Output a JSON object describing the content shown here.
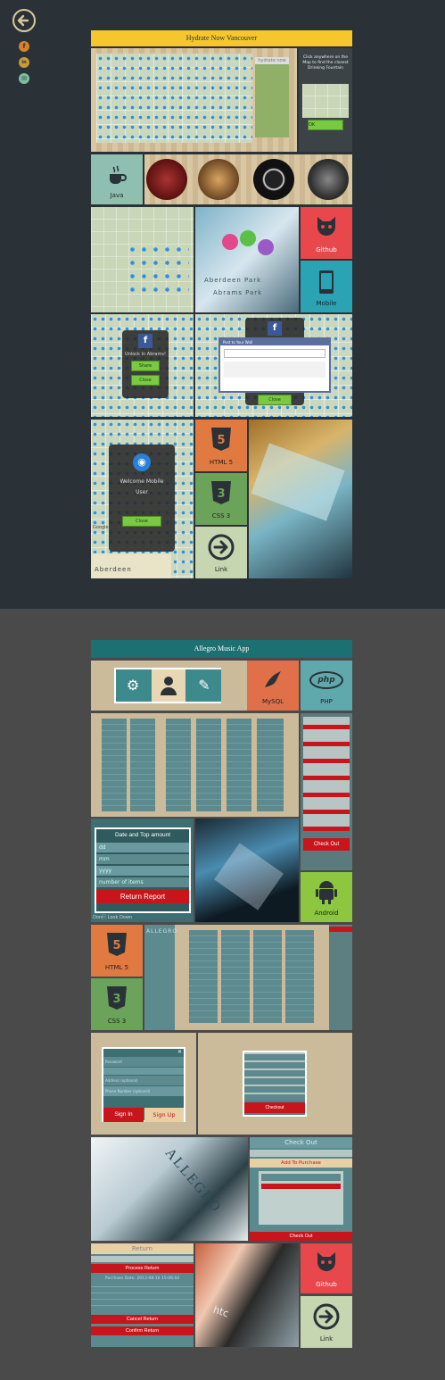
{
  "nav": {
    "back_icon": "circle-arrow-left-icon"
  },
  "social": {
    "items": [
      {
        "icon": "facebook-icon",
        "glyph": "f",
        "color": "#d9822b"
      },
      {
        "icon": "linkedin-icon",
        "glyph": "in",
        "color": "#c79a3a"
      },
      {
        "icon": "email-icon",
        "glyph": "✉",
        "color": "#7fbf9f"
      }
    ]
  },
  "project1": {
    "title": "Hydrate Now Vancouver",
    "header_color": "#f5c72c",
    "hero_modal_text": "Click anywhere on the Map to find the closest Drinking Fountain",
    "hero_ok": "OK",
    "map_logo": "hydrate now",
    "tile_java": "Java",
    "tile_github": "Github",
    "tile_mobile": "Mobile",
    "park_label_1": "Aberdeen Park",
    "park_label_2": "Abrams Park",
    "fb_modal_title": "Unlock In Abrams!",
    "fb_share": "Share",
    "fb_close": "Close",
    "post_dialog_title": "Post to Your Wall",
    "post_dialog_close": "Close",
    "welcome_title": "Welcome Mobile User",
    "welcome_close": "Close",
    "welcome_logo": "hydrate",
    "aberdeen": "Aberdeen",
    "tile_html5": "HTML 5",
    "tile_css3": "CSS 3",
    "tile_link": "Link",
    "google": "Google"
  },
  "project2": {
    "title": "Allegro Music App",
    "header_color": "#1d7071",
    "tile_mysql": "MySQL",
    "tile_php": "PHP",
    "php_logo": "php",
    "check_out": "Check Out",
    "date_modal_title": "Date and Top amount",
    "date_fields": [
      "dd",
      "mm",
      "yyyy",
      "number of items"
    ],
    "return_report": "Return Report",
    "look_down": "Don\u0012 Look Down",
    "tile_android": "Android",
    "tile_html5": "HTML 5",
    "tile_css3": "CSS 3",
    "allegro_logo": "ALLEGRO",
    "login_fields": [
      "Password",
      "Address (optional)",
      "Phone Number (optional)"
    ],
    "sign_in": "Sign In",
    "sign_up": "Sign Up",
    "cart_checkout": "Checkout",
    "checkout_header": "Check Out",
    "add_to_purchase": "Add To Purchase",
    "check_out_btn": "Check Out",
    "return_header": "Return",
    "process_return": "Process Return",
    "purchase_date": "Purchase Date: 2013-08-10 15:06:04",
    "cancel_return": "Cancel Return",
    "confirm_return": "Confirm Return",
    "tile_github": "Github",
    "tile_link": "Link",
    "htc": "htc"
  }
}
